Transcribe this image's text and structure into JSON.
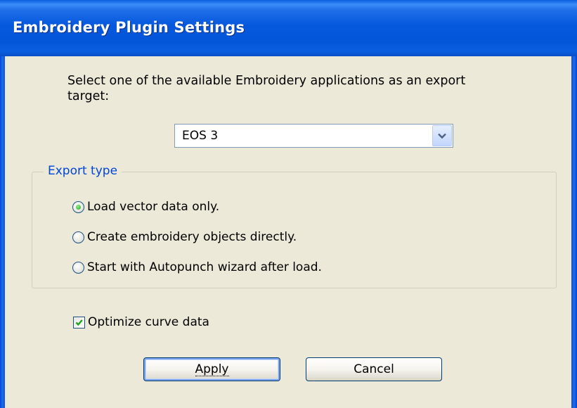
{
  "window": {
    "title": "Embroidery Plugin Settings"
  },
  "instruction": {
    "text": "Select one of the available Embroidery applications as an export target:"
  },
  "target_select": {
    "selected": "EOS 3",
    "icon": "chevron-down-icon"
  },
  "export_type": {
    "legend": "Export type",
    "options": [
      {
        "label": "Load vector data only.",
        "checked": true
      },
      {
        "label": "Create embroidery objects directly.",
        "checked": false
      },
      {
        "label": "Start with Autopunch wizard after load.",
        "checked": false
      }
    ]
  },
  "optimize": {
    "label": "Optimize curve data",
    "checked": true
  },
  "buttons": {
    "apply": "Apply",
    "cancel": "Cancel"
  },
  "colors": {
    "titlebar": "#0558dd",
    "dialog_bg": "#ece9d8",
    "group_legend": "#0046d5",
    "radio_dot": "#21a121",
    "check_mark": "#21a121"
  }
}
